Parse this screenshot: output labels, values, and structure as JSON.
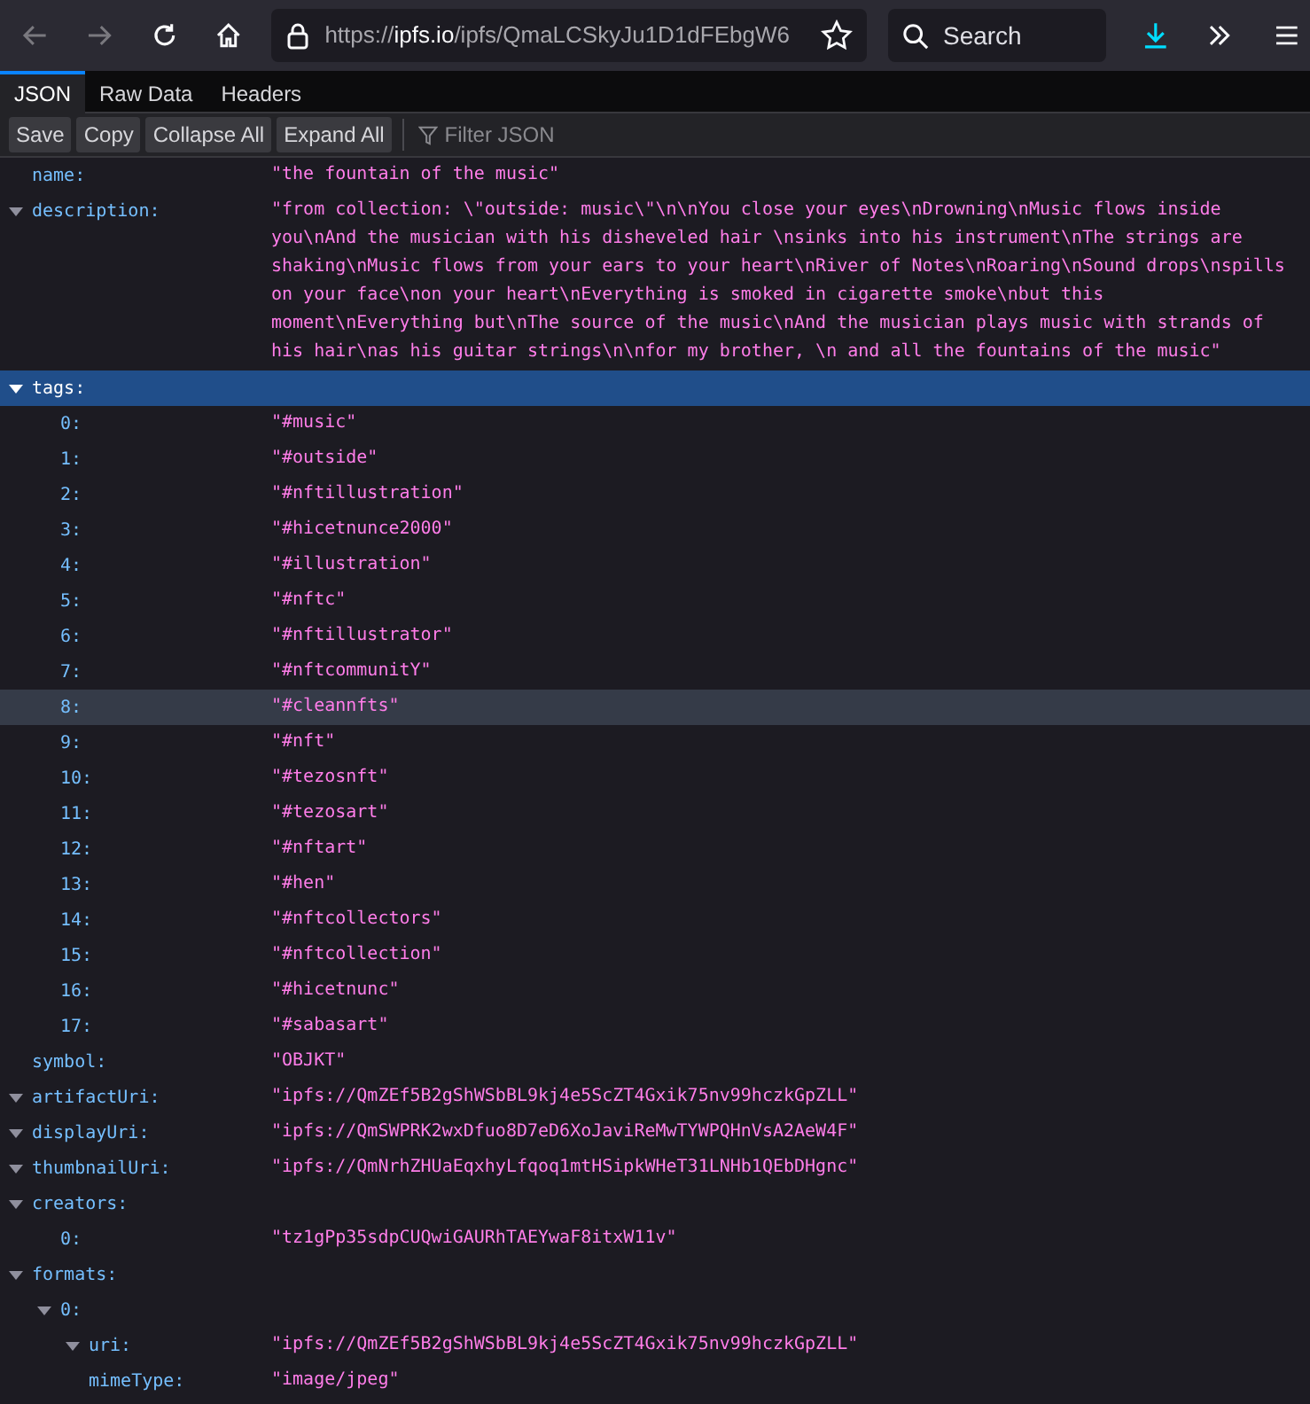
{
  "toolbar": {
    "url_scheme": "https://",
    "url_host": "ipfs.io",
    "url_path": "/ipfs/QmaLCSkyJu1D1dFEbgW6",
    "search_placeholder": "Search"
  },
  "tabs": [
    {
      "label": "JSON",
      "selected": true
    },
    {
      "label": "Raw Data",
      "selected": false
    },
    {
      "label": "Headers",
      "selected": false
    }
  ],
  "buttons": [
    "Save",
    "Copy",
    "Collapse All",
    "Expand All"
  ],
  "filter": {
    "placeholder": "Filter JSON"
  },
  "rows": [
    {
      "key": "name:",
      "value": "\"the fountain of the music\"",
      "selected": false,
      "hovered": false
    },
    {
      "key": "description:",
      "value": "\"from collection: \\\"outside: music\\\"\\n\\nYou close your eyes\\nDrowning\\nMusic flows inside you\\nAnd the musician with his disheveled hair \\nsinks into his instrument\\nThe strings are shaking\\nMusic flows from your ears to your heart\\nRiver of Notes\\nRoaring\\nSound drops\\nspills on your face\\non your heart\\nEverything is smoked in cigarette smoke\\nbut this moment\\nEverything but\\nThe source of the music\\nAnd the musician plays music with strands of his hair\\nas his guitar strings\\n\\nfor my brother, \\n and all the fountains of the music\"",
      "expanded": true,
      "selected": false,
      "hovered": false
    },
    {
      "key": "tags:",
      "expanded": true,
      "selected": true,
      "hovered": false,
      "children": [
        {
          "key": "0:",
          "value": "\"#music\"",
          "selected": false,
          "hovered": false
        },
        {
          "key": "1:",
          "value": "\"#outside\"",
          "selected": false,
          "hovered": false
        },
        {
          "key": "2:",
          "value": "\"#nftillustration\"",
          "selected": false,
          "hovered": false
        },
        {
          "key": "3:",
          "value": "\"#hicetnunce2000\"",
          "selected": false,
          "hovered": false
        },
        {
          "key": "4:",
          "value": "\"#illustration\"",
          "selected": false,
          "hovered": false
        },
        {
          "key": "5:",
          "value": "\"#nftc\"",
          "selected": false,
          "hovered": false
        },
        {
          "key": "6:",
          "value": "\"#nftillustrator\"",
          "selected": false,
          "hovered": false
        },
        {
          "key": "7:",
          "value": "\"#nftcommunitY\"",
          "selected": false,
          "hovered": false
        },
        {
          "key": "8:",
          "value": "\"#cleannfts\"",
          "selected": false,
          "hovered": true
        },
        {
          "key": "9:",
          "value": "\"#nft\"",
          "selected": false,
          "hovered": false
        },
        {
          "key": "10:",
          "value": "\"#tezosnft\"",
          "selected": false,
          "hovered": false
        },
        {
          "key": "11:",
          "value": "\"#tezosart\"",
          "selected": false,
          "hovered": false
        },
        {
          "key": "12:",
          "value": "\"#nftart\"",
          "selected": false,
          "hovered": false
        },
        {
          "key": "13:",
          "value": "\"#hen\"",
          "selected": false,
          "hovered": false
        },
        {
          "key": "14:",
          "value": "\"#nftcollectors\"",
          "selected": false,
          "hovered": false
        },
        {
          "key": "15:",
          "value": "\"#nftcollection\"",
          "selected": false,
          "hovered": false
        },
        {
          "key": "16:",
          "value": "\"#hicetnunc\"",
          "selected": false,
          "hovered": false
        },
        {
          "key": "17:",
          "value": "\"#sabasart\"",
          "selected": false,
          "hovered": false
        }
      ]
    },
    {
      "key": "symbol:",
      "value": "\"OBJKT\"",
      "selected": false,
      "hovered": false
    },
    {
      "key": "artifactUri:",
      "value": "\"ipfs://QmZEf5B2gShWSbBL9kj4e5ScZT4Gxik75nv99hczkGpZLL\"",
      "expanded": true,
      "selected": false,
      "hovered": false
    },
    {
      "key": "displayUri:",
      "value": "\"ipfs://QmSWPRK2wxDfuo8D7eD6XoJaviReMwTYWPQHnVsA2AeW4F\"",
      "expanded": true,
      "selected": false,
      "hovered": false
    },
    {
      "key": "thumbnailUri:",
      "value": "\"ipfs://QmNrhZHUaEqxhyLfqoq1mtHSipkWHeT31LNHb1QEbDHgnc\"",
      "expanded": true,
      "selected": false,
      "hovered": false
    },
    {
      "key": "creators:",
      "expanded": true,
      "selected": false,
      "hovered": false,
      "children": [
        {
          "key": "0:",
          "value": "\"tz1gPp35sdpCUQwiGAURhTAEYwaF8itxW11v\"",
          "selected": false,
          "hovered": false
        }
      ]
    },
    {
      "key": "formats:",
      "expanded": true,
      "selected": false,
      "hovered": false,
      "children": [
        {
          "key": "0:",
          "expanded": true,
          "selected": false,
          "hovered": false,
          "children": [
            {
              "key": "uri:",
              "value": "\"ipfs://QmZEf5B2gShWSbBL9kj4e5ScZT4Gxik75nv99hczkGpZLL\"",
              "expanded": true,
              "selected": false,
              "hovered": false
            },
            {
              "key": "mimeType:",
              "value": "\"image/jpeg\"",
              "selected": false,
              "hovered": false
            }
          ]
        }
      ]
    }
  ]
}
